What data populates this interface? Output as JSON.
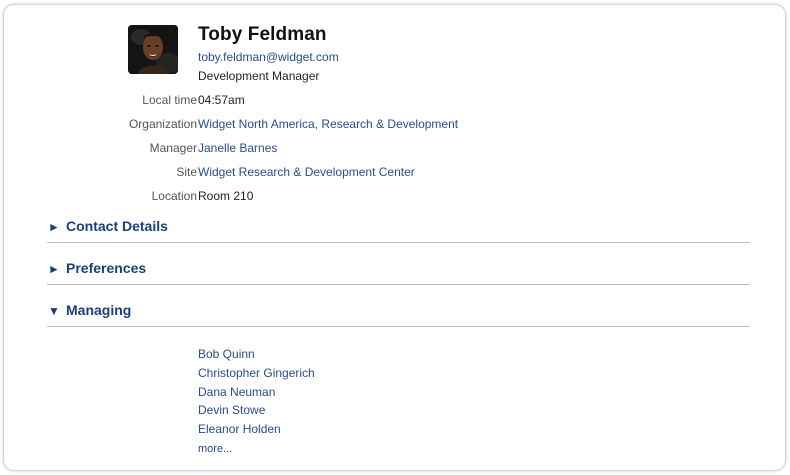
{
  "profile": {
    "name": "Toby Feldman",
    "email": "toby.feldman@widget.com",
    "job_title": "Development Manager",
    "avatar_icon": "person-photo"
  },
  "details": [
    {
      "label": "Local time",
      "value": "04:57am",
      "is_link": false
    },
    {
      "label": "Organization",
      "value": "Widget North America, Research & Development",
      "is_link": true
    },
    {
      "label": "Manager",
      "value": "Janelle Barnes",
      "is_link": true
    },
    {
      "label": "Site",
      "value": "Widget Research & Development Center",
      "is_link": true
    },
    {
      "label": "Location",
      "value": "Room 210",
      "is_link": false
    }
  ],
  "sections": [
    {
      "label": "Contact Details",
      "expanded": false,
      "arrow": "►"
    },
    {
      "label": "Preferences",
      "expanded": false,
      "arrow": "►"
    },
    {
      "label": "Managing",
      "expanded": true,
      "arrow": "▼"
    }
  ],
  "managing": {
    "people": [
      "Bob Quinn",
      "Christopher Gingerich",
      "Dana Neuman",
      "Devin Stowe",
      "Eleanor Holden"
    ],
    "more_label": "more..."
  },
  "colors": {
    "link": "#2a4d8a",
    "section_heading": "#1a3f7a",
    "divider": "#bdbdbd"
  }
}
